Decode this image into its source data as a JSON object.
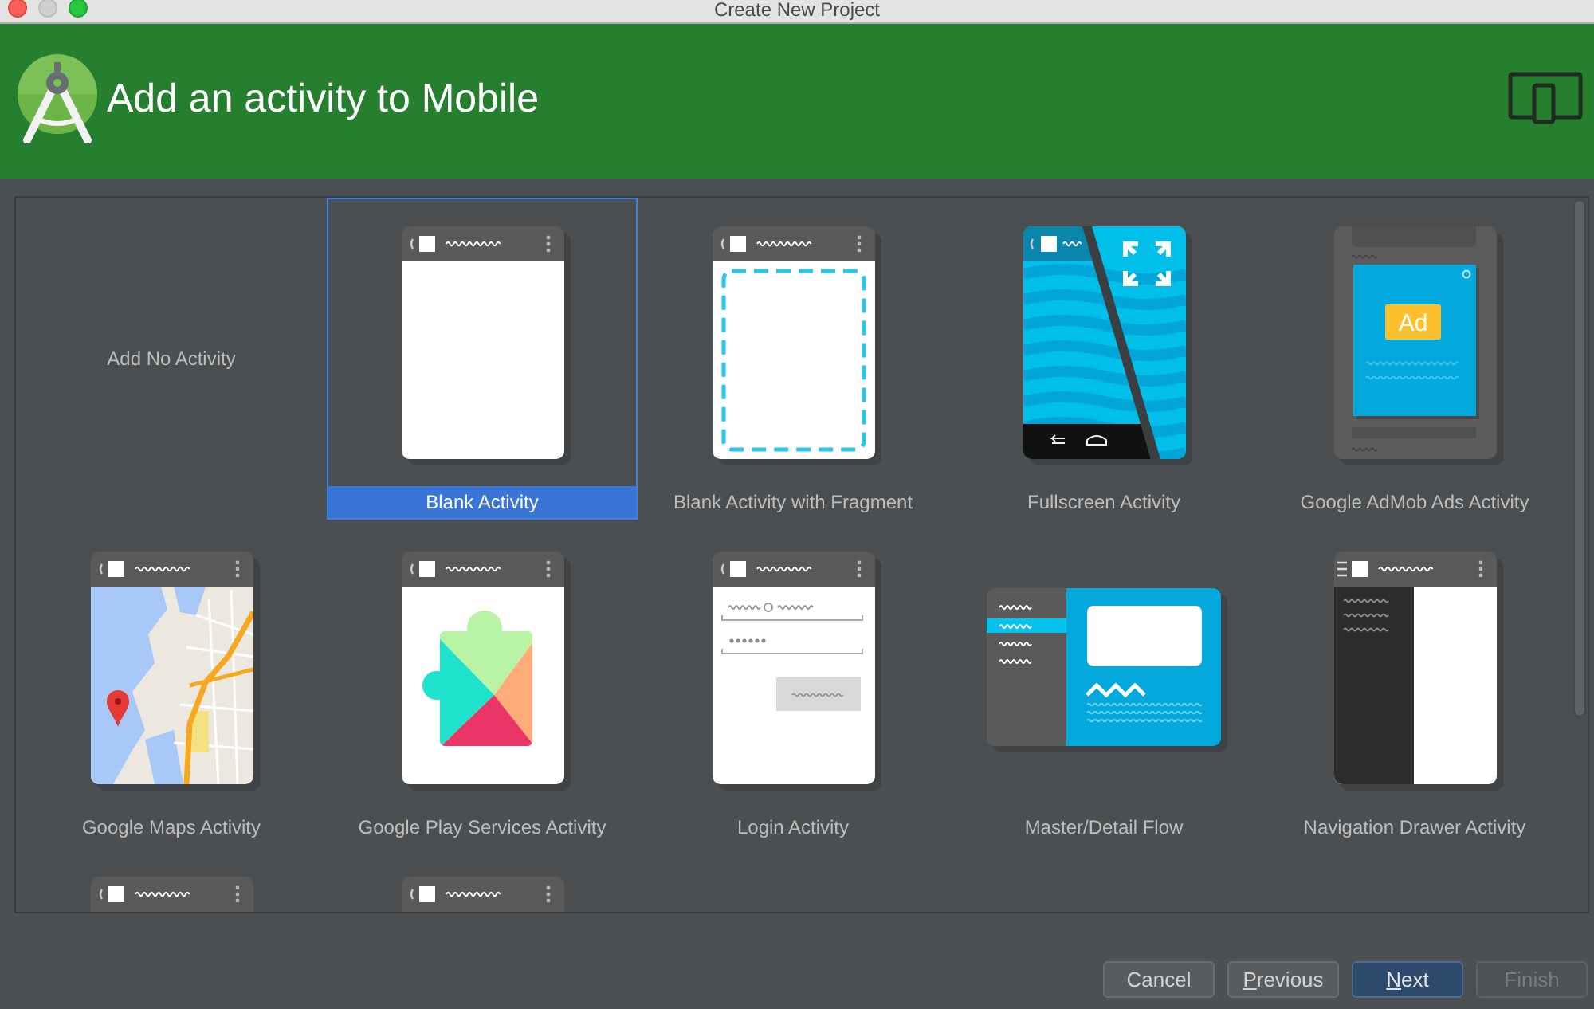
{
  "window": {
    "title": "Create New Project",
    "controls": [
      {
        "kind": "close",
        "disabled": false
      },
      {
        "kind": "minimize",
        "disabled": true
      },
      {
        "kind": "zoom",
        "disabled": false
      }
    ]
  },
  "header": {
    "title": "Add an activity to Mobile"
  },
  "templates": [
    {
      "name": "Add No Activity",
      "kind": "none",
      "selected": false
    },
    {
      "name": "Blank Activity",
      "kind": "blank",
      "selected": true
    },
    {
      "name": "Blank Activity with Fragment",
      "kind": "fragment",
      "selected": false
    },
    {
      "name": "Fullscreen Activity",
      "kind": "fullscreen",
      "selected": false
    },
    {
      "name": "Google AdMob Ads Activity",
      "kind": "admob",
      "badge": "Ad",
      "selected": false
    },
    {
      "name": "Google Maps Activity",
      "kind": "maps",
      "selected": false
    },
    {
      "name": "Google Play Services Activity",
      "kind": "play",
      "selected": false
    },
    {
      "name": "Login Activity",
      "kind": "login",
      "selected": false
    },
    {
      "name": "Master/Detail Flow",
      "kind": "master_detail",
      "selected": false
    },
    {
      "name": "Navigation Drawer Activity",
      "kind": "drawer",
      "selected": false
    },
    {
      "kind": "partial",
      "selected": false
    },
    {
      "kind": "partial",
      "selected": false
    }
  ],
  "buttons": [
    {
      "label": "Cancel",
      "default": false,
      "disabled": false,
      "mnemonic": false
    },
    {
      "label": "Previous",
      "default": false,
      "disabled": false,
      "mnemonic": true
    },
    {
      "label": "Next",
      "default": true,
      "disabled": false,
      "mnemonic": true
    },
    {
      "label": "Finish",
      "default": false,
      "disabled": true,
      "mnemonic": false
    }
  ]
}
